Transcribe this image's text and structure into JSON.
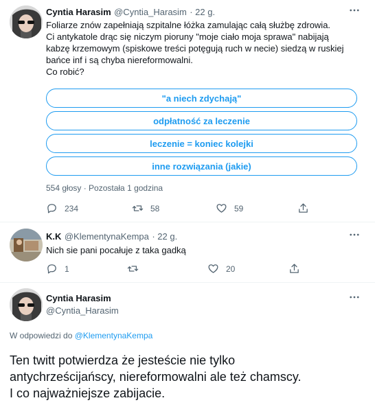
{
  "tweet1": {
    "name": "Cyntia Harasim",
    "handle": "@Cyntia_Harasim",
    "time": "· 22 g.",
    "text_lines": [
      "Foliarze znów zapełniają szpitalne łóżka zamulając całą służbę zdrowia.",
      "Ci antykatole drąc się niczym pioruny \"moje ciało moja sprawa\" nabijają",
      "kabzę krzemowym (spiskowe treści potęgują ruch w necie) siedzą w ruskiej",
      "bańce inf i są chyba niereformowalni.",
      "Co robić?"
    ],
    "poll_options": [
      "\"a niech zdychają\"",
      "odpłatność za leczenie",
      "leczenie = koniec kolejki",
      "inne rozwiązania (jakie)"
    ],
    "poll_meta": "554 głosy · Pozostała 1 godzina",
    "replies": "234",
    "retweets": "58",
    "likes": "59"
  },
  "tweet2": {
    "name": "K.K",
    "handle": "@KlementynaKempa",
    "time": "· 22 g.",
    "text": "Nich sie pani pocałuje z taka gadką",
    "replies": "1",
    "retweets": "",
    "likes": "20"
  },
  "tweet3": {
    "name": "Cyntia Harasim",
    "handle": "@Cyntia_Harasim",
    "reply_prefix": "W odpowiedzi do",
    "reply_to": "@KlementynaKempa",
    "text_lines": [
      "Ten twitt potwierdza że jesteście nie tylko",
      "antychrześcijańscy, niereformowalni ale też chamscy.",
      "I co najważniejsze zabijacie."
    ]
  },
  "icons": {
    "more": "more-horizontal-icon",
    "reply": "reply-icon",
    "retweet": "retweet-icon",
    "like": "heart-icon",
    "share": "share-icon"
  },
  "colors": {
    "accent": "#1d9bf0",
    "secondary_text": "#536471",
    "primary_text": "#0f1419"
  }
}
